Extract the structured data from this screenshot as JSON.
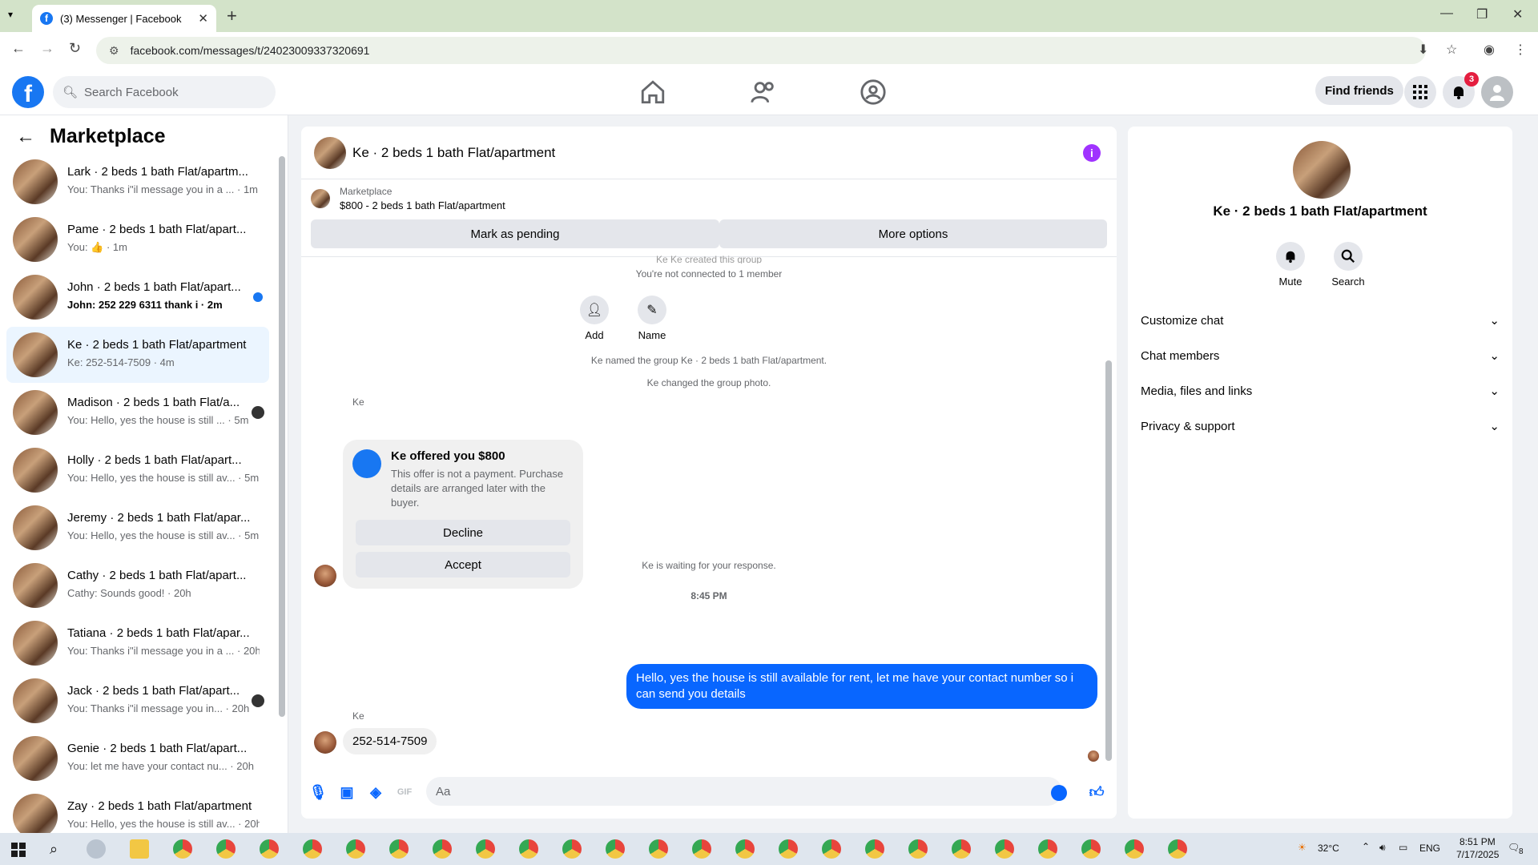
{
  "browser": {
    "tab_title": "(3) Messenger | Facebook",
    "url": "facebook.com/messages/t/24023009337320691"
  },
  "header": {
    "search_placeholder": "Search Facebook",
    "find_friends": "Find friends",
    "notif_count": "3"
  },
  "sidebar": {
    "title": "Marketplace",
    "conversations": [
      {
        "name": "Lark · 2 beds 1 bath Flat/apartm...",
        "preview": "You: Thanks i\"il message you in a ... · 1m",
        "indicator": "none"
      },
      {
        "name": "Pame · 2 beds 1 bath Flat/apart...",
        "preview": "You: 👍 · 1m",
        "indicator": "none"
      },
      {
        "name": "John · 2 beds 1 bath Flat/apart...",
        "preview": "John: 252 229 6311 thank i · 2m",
        "indicator": "unread",
        "bold": true
      },
      {
        "name": "Ke · 2 beds 1 bath Flat/apartment",
        "preview": "Ke: 252-514-7509 · 4m",
        "indicator": "none",
        "active": true
      },
      {
        "name": "Madison · 2 beds 1 bath Flat/a...",
        "preview": "You: Hello, yes the house is still ... · 5m",
        "indicator": "seen"
      },
      {
        "name": "Holly · 2 beds 1 bath Flat/apart...",
        "preview": "You: Hello, yes the house is still av... · 5m",
        "indicator": "none"
      },
      {
        "name": "Jeremy · 2 beds 1 bath Flat/apar...",
        "preview": "You: Hello, yes the house is still av... · 5m",
        "indicator": "none"
      },
      {
        "name": "Cathy · 2 beds 1 bath Flat/apart...",
        "preview": "Cathy: Sounds good! · 20h",
        "indicator": "none"
      },
      {
        "name": "Tatiana · 2 beds 1 bath Flat/apar...",
        "preview": "You: Thanks i\"il message you in a ... · 20h",
        "indicator": "none"
      },
      {
        "name": "Jack · 2 beds 1 bath Flat/apart...",
        "preview": "You: Thanks i\"il message you in... · 20h",
        "indicator": "seen"
      },
      {
        "name": "Genie · 2 beds 1 bath Flat/apart...",
        "preview": "You: let me have your contact nu... · 20h",
        "indicator": "none"
      },
      {
        "name": "Zay · 2 beds 1 bath Flat/apartment",
        "preview": "You: Hello, yes the house is still av... · 20h",
        "indicator": "none"
      }
    ]
  },
  "chat": {
    "title": "Ke · 2 beds 1 bath Flat/apartment",
    "marketplace_label": "Marketplace",
    "listing": "$800 - 2 beds 1 bath Flat/apartment",
    "mark_pending": "Mark as pending",
    "more_options": "More options",
    "created": "Ke Ke created this group",
    "not_connected": "You're not connected to 1 member",
    "add_label": "Add",
    "name_label": "Name",
    "named_group": "Ke named the group Ke · 2 beds 1 bath Flat/apartment.",
    "changed_photo": "Ke changed the group photo.",
    "sender": "Ke",
    "offer_title": "Ke offered you $800",
    "offer_desc": "This offer is not a payment. Purchase details are arranged later with the buyer.",
    "decline": "Decline",
    "accept": "Accept",
    "waiting": "Ke is waiting for your response.",
    "time": "8:45 PM",
    "outgoing": "Hello, yes the house is still available for rent, let me have your contact number so i can send you details",
    "incoming_sender": "Ke",
    "incoming": "252-514-7509",
    "composer_placeholder": "Aa"
  },
  "details": {
    "title": "Ke · 2 beds 1 bath Flat/apartment",
    "mute": "Mute",
    "search": "Search",
    "sections": [
      "Customize chat",
      "Chat members",
      "Media, files and links",
      "Privacy & support"
    ]
  },
  "taskbar": {
    "weather": "32°C",
    "lang": "ENG",
    "time": "8:51 PM",
    "date": "7/17/2025",
    "notif": "8"
  },
  "colors": {
    "accent": "#0866ff",
    "brand": "#1877f2",
    "info": "#a033ff"
  }
}
